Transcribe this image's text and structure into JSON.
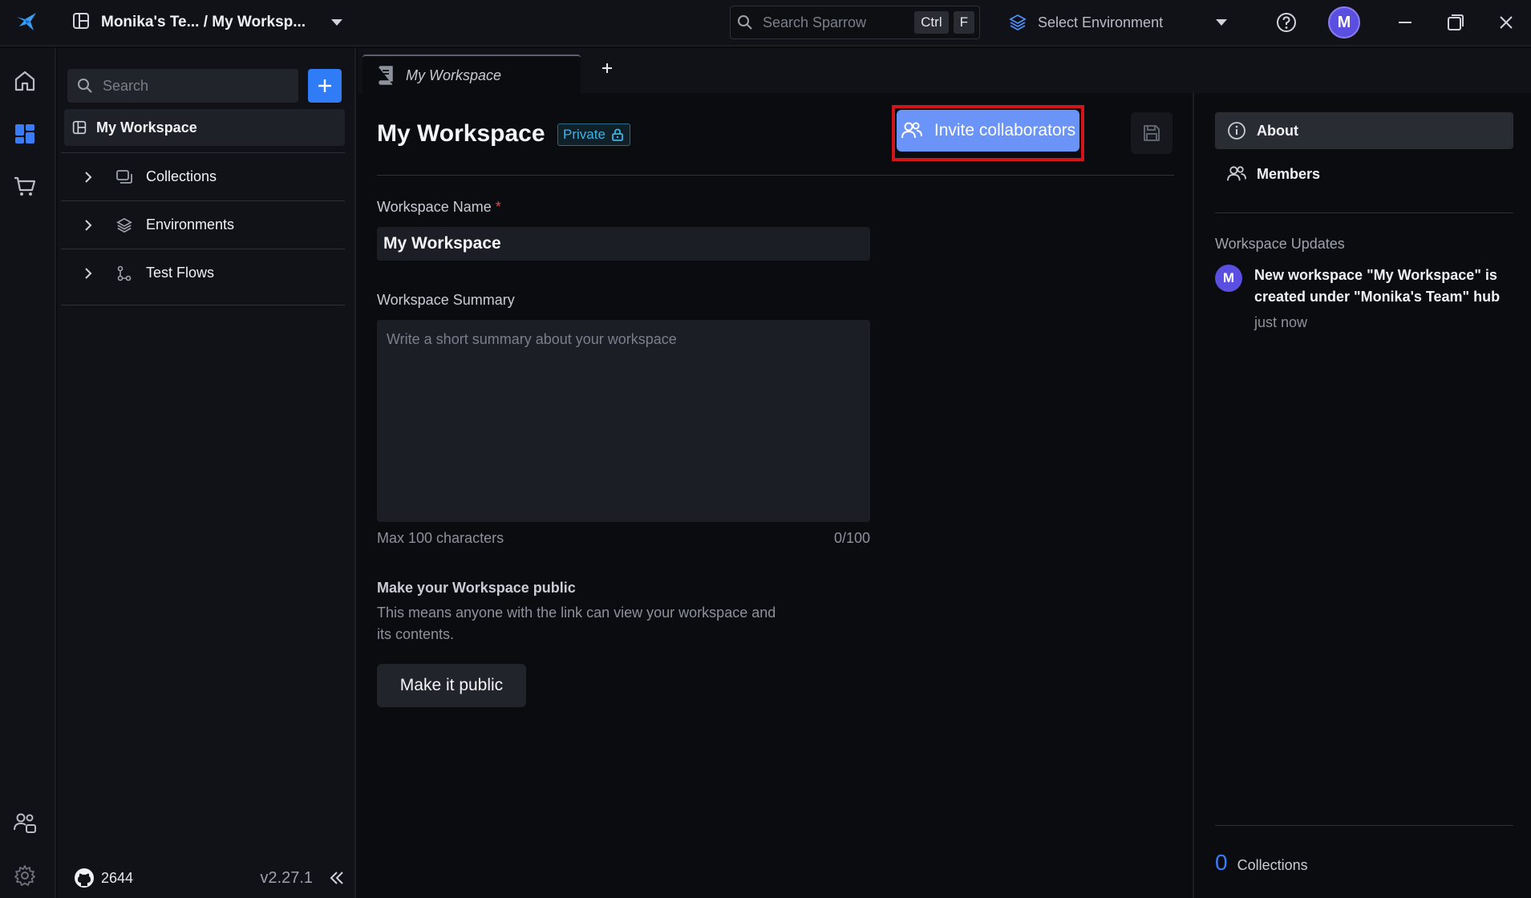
{
  "topbar": {
    "workspace_path": "Monika's Te... / My Worksp...",
    "search_placeholder": "Search Sparrow",
    "search_shortcut_key1": "Ctrl",
    "search_shortcut_key2": "F",
    "environment_label": "Select Environment",
    "avatar_initial": "M"
  },
  "sidebar": {
    "search_placeholder": "Search",
    "workspace_label": "My Workspace",
    "items": [
      {
        "label": "Collections",
        "icon": "collections-icon"
      },
      {
        "label": "Environments",
        "icon": "layers-icon"
      },
      {
        "label": "Test Flows",
        "icon": "flow-icon"
      }
    ],
    "github_stars": "2644",
    "version": "v2.27.1"
  },
  "tabs": [
    {
      "label": "My Workspace"
    }
  ],
  "main": {
    "title": "My Workspace",
    "visibility_badge": "Private",
    "invite_button": "Invite collaborators",
    "name_label": "Workspace Name",
    "required_marker": "*",
    "name_value": "My Workspace",
    "summary_label": "Workspace Summary",
    "summary_placeholder": "Write a short summary about your workspace",
    "summary_hint": "Max 100 characters",
    "summary_count": "0/100",
    "public_title": "Make your Workspace public",
    "public_desc": "This means anyone with the link can view your workspace and its contents.",
    "public_button": "Make it public"
  },
  "right_panel": {
    "nav": [
      {
        "label": "About",
        "icon": "info-icon"
      },
      {
        "label": "Members",
        "icon": "members-icon"
      }
    ],
    "updates_title": "Workspace Updates",
    "update_avatar": "M",
    "update_text": "New workspace \"My Workspace\" is created under \"Monika's Team\" hub",
    "update_time": "just now",
    "collections_count": "0",
    "collections_label": "Collections"
  },
  "colors": {
    "accent": "#2f7cf6",
    "invite_button": "#6b94f8",
    "highlight_outline": "#d0161a",
    "private_badge": "#3fb2e4"
  }
}
